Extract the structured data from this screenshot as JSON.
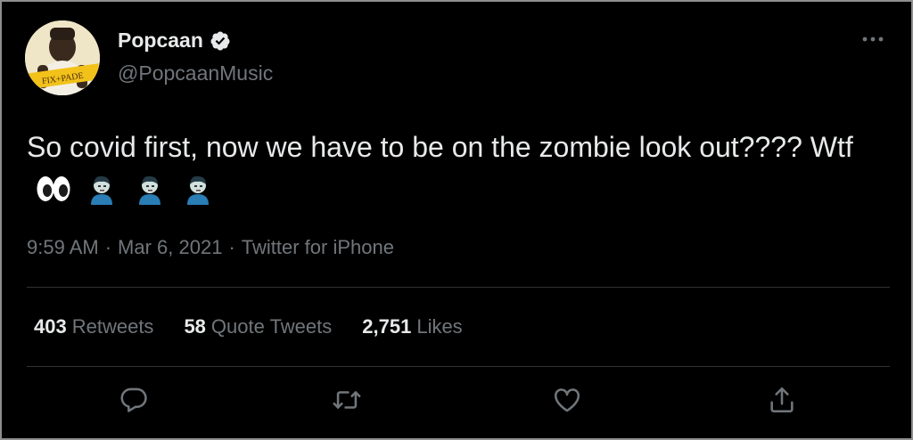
{
  "author": {
    "name": "Popcaan",
    "handle": "@PopcaanMusic",
    "verified": true,
    "avatar_text": "FIX+PADE"
  },
  "tweet": {
    "text": "So covid first, now we have to be on the zombie look out???? Wtf",
    "emojis": [
      "eyes-emoji",
      "zombie-emoji",
      "zombie-emoji",
      "zombie-emoji"
    ]
  },
  "meta": {
    "time": "9:59 AM",
    "sep1": "·",
    "date": "Mar 6, 2021",
    "sep2": "·",
    "source": "Twitter for iPhone"
  },
  "stats": {
    "retweets_count": "403",
    "retweets_label": "Retweets",
    "quotes_count": "58",
    "quotes_label": "Quote Tweets",
    "likes_count": "2,751",
    "likes_label": "Likes"
  },
  "actions": [
    "reply-icon",
    "retweet-icon",
    "like-icon",
    "share-icon"
  ],
  "colors": {
    "background": "#000000",
    "text_primary": "#e7e9ea",
    "text_secondary": "#71767b",
    "divider": "#2f3336",
    "verified_badge": "#e7e9ea"
  }
}
